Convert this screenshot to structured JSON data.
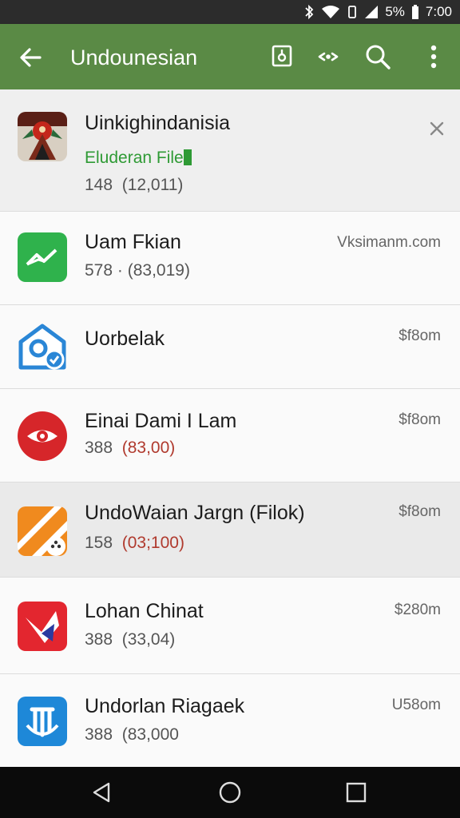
{
  "status_bar": {
    "battery": "5%",
    "time": "7:00",
    "icons": [
      "bluetooth-icon",
      "wifi-icon",
      "vibrate-icon",
      "signal-icon",
      "battery-icon"
    ]
  },
  "app_bar": {
    "title": "Undounesian",
    "actions": [
      "back-arrow-icon",
      "install-icon",
      "share-icon",
      "search-icon",
      "more-vert-icon"
    ]
  },
  "header_item": {
    "name": "Uinkighindanisia",
    "tag": "Eluderan File",
    "sub_prefix": "148",
    "sub_count": "(12,011)"
  },
  "items": [
    {
      "name": "Uam Fkian",
      "sub_prefix": "578 ·",
      "sub_count": "(83,019)",
      "size": "Vksimanm.com"
    },
    {
      "name": "Uorbelak",
      "sub_prefix": "",
      "sub_count": "",
      "size": "$f8om"
    },
    {
      "name": "Einai Dami I Lam",
      "sub_prefix": "388",
      "sub_count": "(83,00)",
      "size": "$f8om"
    },
    {
      "name": "UndoWaian Jargn (Filok)",
      "sub_prefix": "158",
      "sub_count": "(03;100)",
      "size": "$f8om"
    },
    {
      "name": "Lohan Chinat",
      "sub_prefix": "388",
      "sub_count": "(33,04)",
      "size": "$280m"
    },
    {
      "name": "Undorlan Riagaek",
      "sub_prefix": "388",
      "sub_count": "(83,000",
      "size": "U58om"
    }
  ],
  "colors": {
    "app_bar": "#5a8a45",
    "accent_green": "#2e9a34",
    "count_red": "#b03a2e"
  }
}
